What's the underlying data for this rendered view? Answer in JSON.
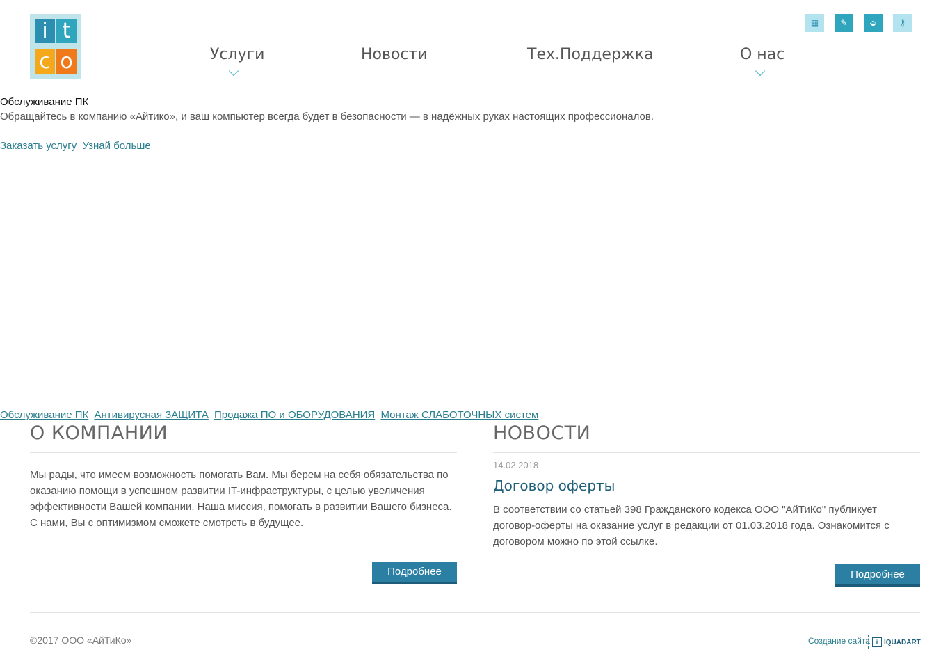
{
  "colors": {
    "accent": "#2b7fa3",
    "link": "#2a7f8f",
    "tool_buttons": [
      "#b3e3ef",
      "#2fa6bd",
      "#2fa6bd",
      "#b3e3ef"
    ]
  },
  "logo": {
    "letters": [
      "i",
      "t",
      "c",
      "o"
    ]
  },
  "nav": {
    "items": [
      {
        "label": "Услуги",
        "has_dropdown": true
      },
      {
        "label": "Новости",
        "has_dropdown": false
      },
      {
        "label": "Тех.Поддержка",
        "has_dropdown": false
      },
      {
        "label": "О нас",
        "has_dropdown": true
      }
    ]
  },
  "toolbar": {
    "icons": [
      "building-icon",
      "edit-icon",
      "download-icon",
      "key-icon"
    ],
    "glyphs": [
      "▦",
      "✎",
      "⬙",
      "⚷"
    ]
  },
  "hero": {
    "title": "Обслуживание ПК",
    "description": "Обращайтесь в компанию «Айтико», и ваш компьютер всегда будет в безопасности — в надёжных руках настоящих профессионалов.",
    "links": [
      "Заказать услугу",
      "Узнай больше"
    ]
  },
  "services": {
    "links": [
      "Обслуживание ПК",
      "Антивирусная ЗАЩИТА",
      "Продажа ПО и ОБОРУДОВАНИЯ",
      "Монтаж СЛАБОТОЧНЫХ систем"
    ]
  },
  "about": {
    "heading": "О КОМПАНИИ",
    "text": "Мы рады, что имеем возможность помогать Вам. Мы берем на себя обязательства по оказанию помощи в успешном развитии IT-инфраструктуры, с целью увеличения эффективности Вашей компании. Наша миссия, помогать в развитии Вашего бизнеса. С нами, Вы с оптимизмом сможете смотреть в будущее.",
    "button": "Подробнее"
  },
  "news": {
    "heading": "НОВОСТИ",
    "date": "14.02.2018",
    "title": "Договор оферты",
    "text": "В соответствии со статьей 398 Гражданского кодекса ООО \"АйТиКо\" публикует договор-оферты на оказание услуг в редакции от 01.03.2018 года. Ознакомится с договором можно по этой ссылке.",
    "button": "Подробнее"
  },
  "footer": {
    "copyright": "©2017 ООО «АйТиКо»",
    "credit": "Создание сайта",
    "credit_logo_mark": "i",
    "credit_logo": "IQUADART"
  }
}
